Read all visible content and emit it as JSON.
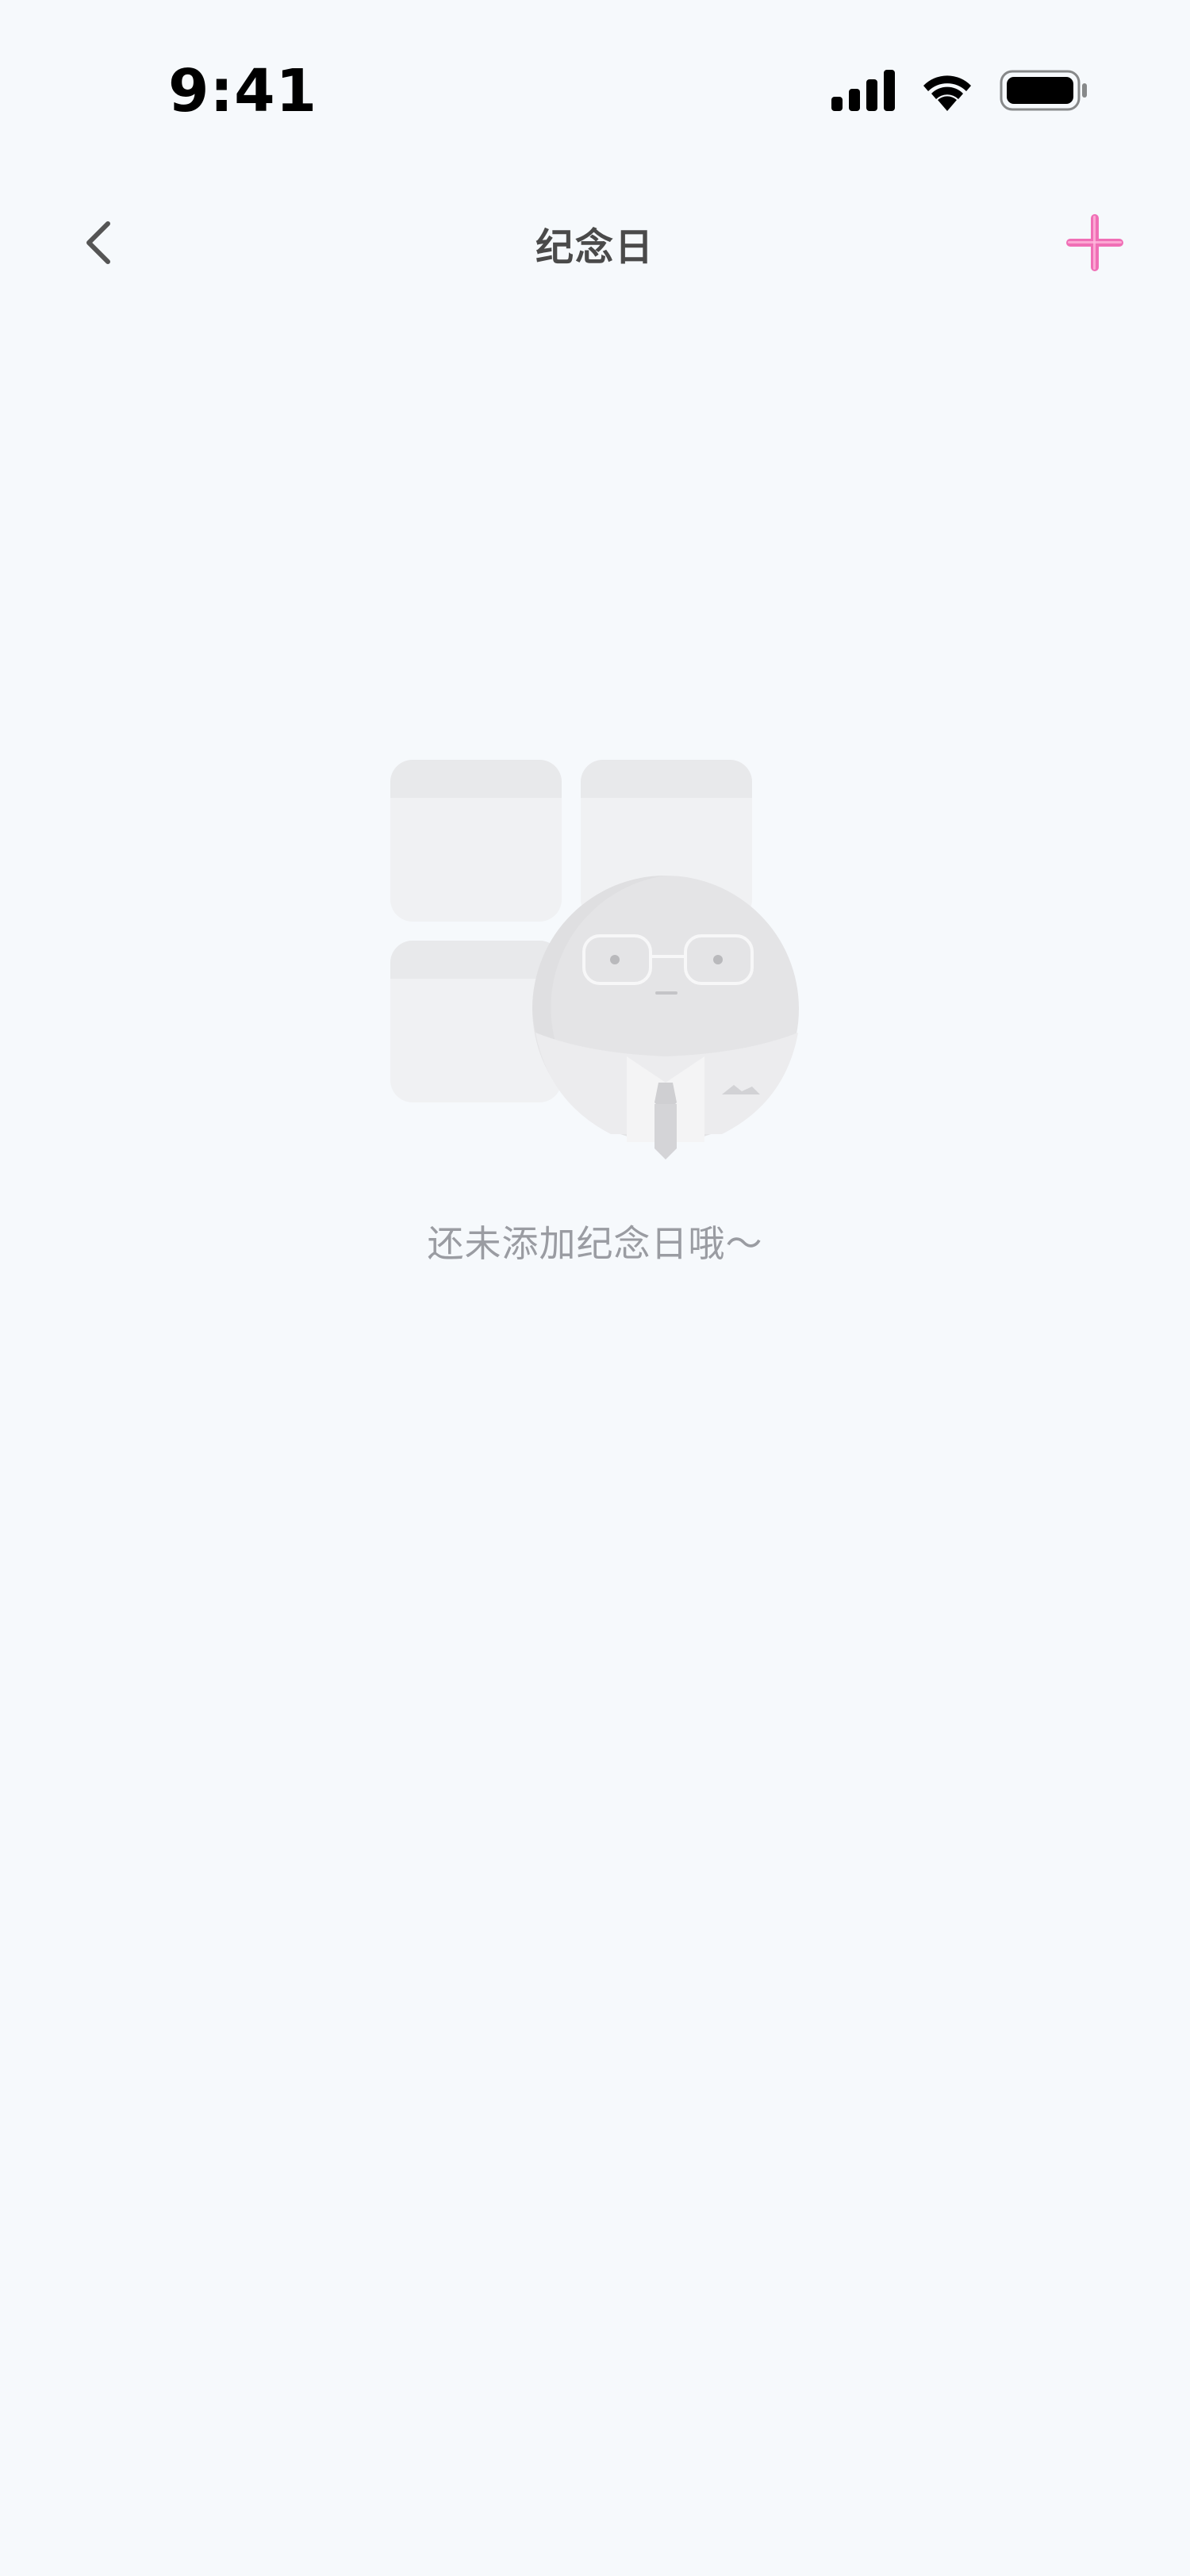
{
  "status_bar": {
    "time": "9:41",
    "icons": [
      "cellular-signal-icon",
      "wifi-icon",
      "battery-icon"
    ]
  },
  "nav": {
    "title": "纪念日",
    "back_icon": "chevron-left-icon",
    "add_icon": "plus-icon"
  },
  "empty_state": {
    "illustration": "empty-calendar-person-illustration",
    "message": "还未添加纪念日哦～"
  },
  "colors": {
    "background": "#f6f9fc",
    "accent": "#f06fb6",
    "title": "#4a4a4a",
    "empty_text": "#9a9ca2"
  }
}
